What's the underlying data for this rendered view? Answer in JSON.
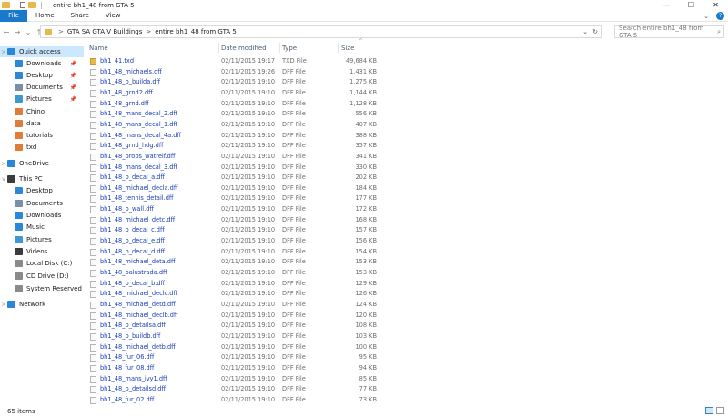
{
  "window": {
    "title": "entire bh1_48 from GTA 5",
    "minimize": "—",
    "maximize": "☐",
    "close": "✕"
  },
  "ribbon": {
    "tabs": [
      "File",
      "Home",
      "Share",
      "View"
    ],
    "expand": "⌄",
    "help": "?"
  },
  "address": {
    "back": "←",
    "forward": "→",
    "recent": "⌄",
    "up": "↑",
    "crumbs": [
      "GTA SA GTA V Buildings",
      "entire bh1_48 from GTA 5"
    ],
    "separator": ">",
    "dropdown": "⌄",
    "refresh": "↻",
    "search_placeholder": "Search entire bh1_48 from GTA 5",
    "search_icon": "⌕"
  },
  "nav": {
    "items": [
      {
        "label": "Quick access",
        "icon": "star-icon",
        "color": "#2b88d8",
        "selected": true,
        "expand": ">"
      },
      {
        "label": "Downloads",
        "icon": "downloads-icon",
        "color": "#2b88d8",
        "pinned": true
      },
      {
        "label": "Desktop",
        "icon": "desktop-icon",
        "color": "#2b88d8",
        "pinned": true
      },
      {
        "label": "Documents",
        "icon": "documents-icon",
        "color": "#7a8fa6",
        "pinned": true
      },
      {
        "label": "Pictures",
        "icon": "pictures-icon",
        "color": "#3c9ad0",
        "pinned": true
      },
      {
        "label": "Chino",
        "icon": "folder-orange-icon",
        "color": "#e07b3a"
      },
      {
        "label": "data",
        "icon": "folder-orange-icon",
        "color": "#e07b3a"
      },
      {
        "label": "tutorials",
        "icon": "folder-orange-icon",
        "color": "#e07b3a"
      },
      {
        "label": "txd",
        "icon": "folder-orange-icon",
        "color": "#e07b3a"
      },
      {
        "label": "OneDrive",
        "icon": "onedrive-icon",
        "color": "#2b88d8",
        "expand": ">"
      },
      {
        "label": "This PC",
        "icon": "pc-icon",
        "color": "#3b3b3b",
        "expand": "v"
      },
      {
        "label": "Desktop",
        "icon": "desktop-icon",
        "color": "#2b88d8"
      },
      {
        "label": "Documents",
        "icon": "documents-icon",
        "color": "#7a8fa6"
      },
      {
        "label": "Downloads",
        "icon": "downloads-icon",
        "color": "#2b88d8"
      },
      {
        "label": "Music",
        "icon": "music-icon",
        "color": "#2b88d8"
      },
      {
        "label": "Pictures",
        "icon": "pictures-icon",
        "color": "#3c9ad0"
      },
      {
        "label": "Videos",
        "icon": "videos-icon",
        "color": "#3b3b3b"
      },
      {
        "label": "Local Disk (C:)",
        "icon": "drive-icon",
        "color": "#8a8a8a"
      },
      {
        "label": "CD Drive (D:)",
        "icon": "cd-drive-icon",
        "color": "#8a8a8a"
      },
      {
        "label": "System Reserved (G",
        "icon": "drive-icon",
        "color": "#8a8a8a"
      },
      {
        "label": "Network",
        "icon": "network-icon",
        "color": "#2b88d8",
        "expand": ">"
      }
    ],
    "pin_glyph": "📌"
  },
  "columns": {
    "sort_caret": "^",
    "name": "Name",
    "date": "Date modified",
    "type": "Type",
    "size": "Size"
  },
  "files": [
    {
      "name": "bh1_41.txd",
      "date": "02/11/2015 19:17",
      "type": "TXD File",
      "size": "49,684 KB",
      "kind": "txd"
    },
    {
      "name": "bh1_48_michaels.dff",
      "date": "02/11/2015 19:26",
      "type": "DFF File",
      "size": "1,431 KB",
      "kind": "dff"
    },
    {
      "name": "bh1_48_b_builda.dff",
      "date": "02/11/2015 19:10",
      "type": "DFF File",
      "size": "1,275 KB",
      "kind": "dff"
    },
    {
      "name": "bh1_48_grnd2.dff",
      "date": "02/11/2015 19:10",
      "type": "DFF File",
      "size": "1,144 KB",
      "kind": "dff"
    },
    {
      "name": "bh1_48_grnd.dff",
      "date": "02/11/2015 19:10",
      "type": "DFF File",
      "size": "1,128 KB",
      "kind": "dff"
    },
    {
      "name": "bh1_48_mans_decal_2.dff",
      "date": "02/11/2015 19:10",
      "type": "DFF File",
      "size": "556 KB",
      "kind": "dff"
    },
    {
      "name": "bh1_48_mans_decal_1.dff",
      "date": "02/11/2015 19:10",
      "type": "DFF File",
      "size": "407 KB",
      "kind": "dff"
    },
    {
      "name": "bh1_48_mans_decal_4a.dff",
      "date": "02/11/2015 19:10",
      "type": "DFF File",
      "size": "388 KB",
      "kind": "dff"
    },
    {
      "name": "bh1_48_grnd_hdg.dff",
      "date": "02/11/2015 19:10",
      "type": "DFF File",
      "size": "357 KB",
      "kind": "dff"
    },
    {
      "name": "bh1_48_props_watrelf.dff",
      "date": "02/11/2015 19:10",
      "type": "DFF File",
      "size": "341 KB",
      "kind": "dff"
    },
    {
      "name": "bh1_48_mans_decal_3.dff",
      "date": "02/11/2015 19:10",
      "type": "DFF File",
      "size": "330 KB",
      "kind": "dff"
    },
    {
      "name": "bh1_48_b_decal_a.dff",
      "date": "02/11/2015 19:10",
      "type": "DFF File",
      "size": "202 KB",
      "kind": "dff"
    },
    {
      "name": "bh1_48_michael_decla.dff",
      "date": "02/11/2015 19:10",
      "type": "DFF File",
      "size": "184 KB",
      "kind": "dff"
    },
    {
      "name": "bh1_48_tennis_detail.dff",
      "date": "02/11/2015 19:10",
      "type": "DFF File",
      "size": "177 KB",
      "kind": "dff"
    },
    {
      "name": "bh1_48_b_wall.dff",
      "date": "02/11/2015 19:10",
      "type": "DFF File",
      "size": "172 KB",
      "kind": "dff"
    },
    {
      "name": "bh1_48_michael_detc.dff",
      "date": "02/11/2015 19:10",
      "type": "DFF File",
      "size": "168 KB",
      "kind": "dff"
    },
    {
      "name": "bh1_48_b_decal_c.dff",
      "date": "02/11/2015 19:10",
      "type": "DFF File",
      "size": "157 KB",
      "kind": "dff"
    },
    {
      "name": "bh1_48_b_decal_e.dff",
      "date": "02/11/2015 19:10",
      "type": "DFF File",
      "size": "156 KB",
      "kind": "dff"
    },
    {
      "name": "bh1_48_b_decal_d.dff",
      "date": "02/11/2015 19:10",
      "type": "DFF File",
      "size": "154 KB",
      "kind": "dff"
    },
    {
      "name": "bh1_48_michael_deta.dff",
      "date": "02/11/2015 19:10",
      "type": "DFF File",
      "size": "153 KB",
      "kind": "dff"
    },
    {
      "name": "bh1_48_balustrada.dff",
      "date": "02/11/2015 19:10",
      "type": "DFF File",
      "size": "153 KB",
      "kind": "dff"
    },
    {
      "name": "bh1_48_b_decal_b.dff",
      "date": "02/11/2015 19:10",
      "type": "DFF File",
      "size": "129 KB",
      "kind": "dff"
    },
    {
      "name": "bh1_48_michael_declc.dff",
      "date": "02/11/2015 19:10",
      "type": "DFF File",
      "size": "126 KB",
      "kind": "dff"
    },
    {
      "name": "bh1_48_michael_detd.dff",
      "date": "02/11/2015 19:10",
      "type": "DFF File",
      "size": "124 KB",
      "kind": "dff"
    },
    {
      "name": "bh1_48_michael_declb.dff",
      "date": "02/11/2015 19:10",
      "type": "DFF File",
      "size": "120 KB",
      "kind": "dff"
    },
    {
      "name": "bh1_48_b_detailsa.dff",
      "date": "02/11/2015 19:10",
      "type": "DFF File",
      "size": "108 KB",
      "kind": "dff"
    },
    {
      "name": "bh1_48_b_buildb.dff",
      "date": "02/11/2015 19:10",
      "type": "DFF File",
      "size": "103 KB",
      "kind": "dff"
    },
    {
      "name": "bh1_48_michael_detb.dff",
      "date": "02/11/2015 19:10",
      "type": "DFF File",
      "size": "100 KB",
      "kind": "dff"
    },
    {
      "name": "bh1_48_fur_06.dff",
      "date": "02/11/2015 19:10",
      "type": "DFF File",
      "size": "95 KB",
      "kind": "dff"
    },
    {
      "name": "bh1_48_fur_08.dff",
      "date": "02/11/2015 19:10",
      "type": "DFF File",
      "size": "94 KB",
      "kind": "dff"
    },
    {
      "name": "bh1_48_mans_ivy1.dff",
      "date": "02/11/2015 19:10",
      "type": "DFF File",
      "size": "85 KB",
      "kind": "dff"
    },
    {
      "name": "bh1_48_b_detailsd.dff",
      "date": "02/11/2015 19:10",
      "type": "DFF File",
      "size": "77 KB",
      "kind": "dff"
    },
    {
      "name": "bh1_48_fur_02.dff",
      "date": "02/11/2015 19:10",
      "type": "DFF File",
      "size": "73 KB",
      "kind": "dff"
    }
  ],
  "status": {
    "count": "65 items"
  }
}
